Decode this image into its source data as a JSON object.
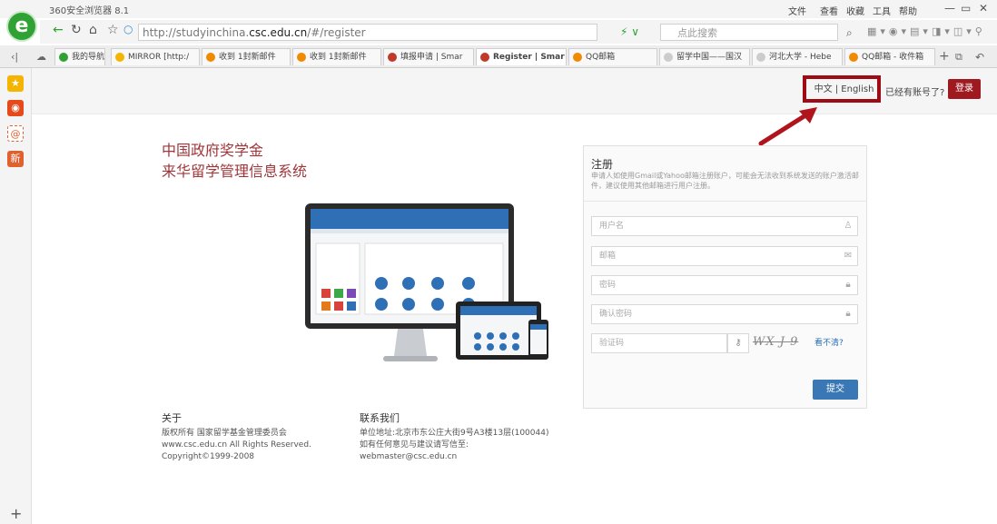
{
  "browser": {
    "title": "360安全浏览器 8.1",
    "menus": [
      "文件",
      "查看",
      "收藏",
      "工具",
      "帮助"
    ],
    "url_prefix": "http://studyinchina.",
    "url_domain": "csc.edu.cn",
    "url_suffix": "/#/register",
    "search_placeholder": "点此搜索",
    "tabs": [
      {
        "label": "我的导航"
      },
      {
        "label": "MIRROR [http:/"
      },
      {
        "label": "收到 1封新邮件"
      },
      {
        "label": "收到 1封新邮件"
      },
      {
        "label": "填报申请 | Smar"
      },
      {
        "label": "Register | Smar"
      },
      {
        "label": "QQ邮箱"
      },
      {
        "label": "留学中国——国汉"
      },
      {
        "label": "河北大学 - Hebe"
      },
      {
        "label": "QQ邮箱 - 收件箱"
      }
    ]
  },
  "header": {
    "lang_switch": "中文 | English",
    "already_have_account": "已经有账号了?",
    "login_label": "登录"
  },
  "brand": {
    "line1": "中国政府奖学金",
    "line2": "来华留学管理信息系统"
  },
  "register": {
    "title": "注册",
    "note": "申请人如使用Gmail或Yahoo邮箱注册账户，可能会无法收到系统发送的账户激活邮件，建议使用其他邮箱进行用户注册。",
    "username_placeholder": "用户名",
    "email_placeholder": "邮箱",
    "password_placeholder": "密码",
    "confirm_placeholder": "确认密码",
    "captcha_placeholder": "验证码",
    "captcha_text": "WX J 9",
    "captcha_refresh": "看不清?",
    "submit_label": "提交"
  },
  "footer": {
    "about_title": "关于",
    "about_lines": [
      "版权所有  国家留学基金管理委员会",
      "www.csc.edu.cn All Rights Reserved.",
      "Copyright©1999-2008"
    ],
    "contact_title": "联系我们",
    "contact_lines": [
      "单位地址:北京市东公庄大街9号A3楼13层(100044)",
      "如有任何意见与建议请写信至:",
      "webmaster@csc.edu.cn"
    ]
  }
}
